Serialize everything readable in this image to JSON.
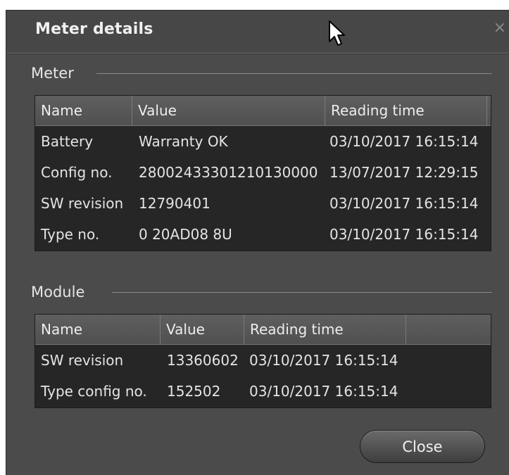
{
  "dialog": {
    "title": "Meter details",
    "close_glyph": "×"
  },
  "meter": {
    "group_label": "Meter",
    "columns": [
      "Name",
      "Value",
      "Reading time"
    ],
    "rows": [
      [
        "Battery",
        "Warranty OK",
        "03/10/2017 16:15:14"
      ],
      [
        "Config no.",
        "28002433301210130000",
        "13/07/2017 12:29:15"
      ],
      [
        "SW revision",
        "12790401",
        "03/10/2017 16:15:14"
      ],
      [
        "Type no.",
        "0 20AD08 8U",
        "03/10/2017 16:15:14"
      ]
    ]
  },
  "module": {
    "group_label": "Module",
    "columns": [
      "Name",
      "Value",
      "Reading time",
      ""
    ],
    "rows": [
      [
        "SW revision",
        "13360602",
        "03/10/2017 16:15:14"
      ],
      [
        "Type config no.",
        "152502",
        "03/10/2017 16:15:14"
      ]
    ]
  },
  "footer": {
    "close_label": "Close"
  },
  "icons": {
    "close": "close-icon",
    "cursor": "mouse-cursor-icon"
  },
  "colors": {
    "dialog_bg": "#4b4b4b",
    "grid_bg": "#262626",
    "header_bg": "#5a5a5a",
    "text": "#e4e4e4"
  }
}
